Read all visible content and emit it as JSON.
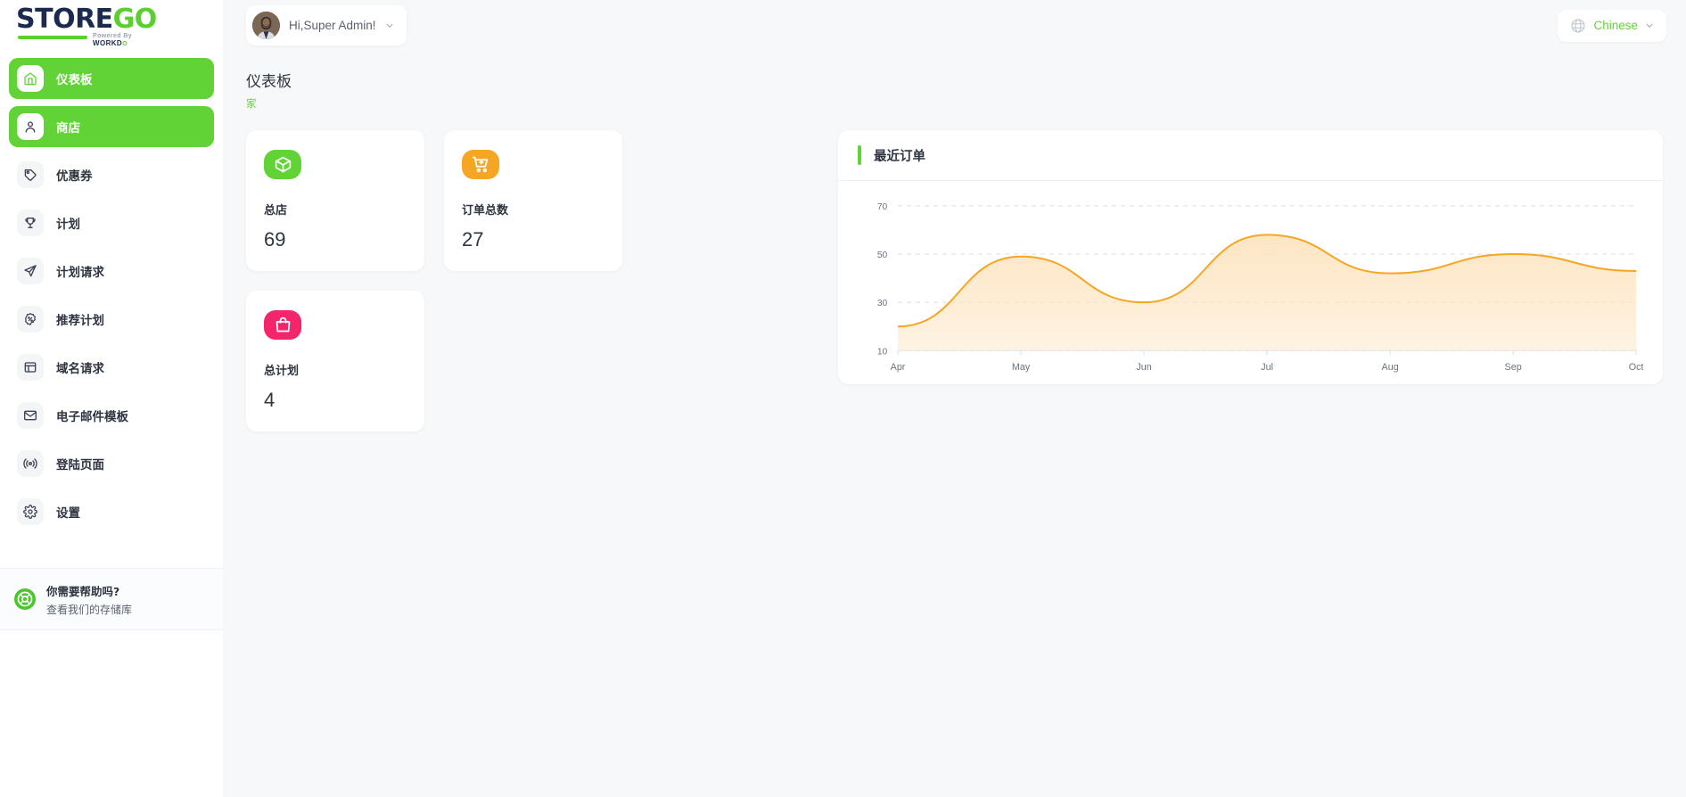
{
  "brand": {
    "logo_part1": "STORE",
    "logo_part2": "GO",
    "powered_prefix": "Powered By ",
    "powered_brand": "WORKD",
    "powered_accent": "O"
  },
  "sidebar": {
    "items": [
      {
        "label": "仪表板",
        "icon": "home-icon",
        "active": true
      },
      {
        "label": "商店",
        "icon": "user-icon",
        "active": true
      },
      {
        "label": "优惠券",
        "icon": "tag-icon",
        "active": false
      },
      {
        "label": "计划",
        "icon": "trophy-icon",
        "active": false
      },
      {
        "label": "计划请求",
        "icon": "send-icon",
        "active": false
      },
      {
        "label": "推荐计划",
        "icon": "percent-badge-icon",
        "active": false
      },
      {
        "label": "域名请求",
        "icon": "window-icon",
        "active": false
      },
      {
        "label": "电子邮件模板",
        "icon": "envelope-icon",
        "active": false
      },
      {
        "label": "登陆页面",
        "icon": "broadcast-icon",
        "active": false
      },
      {
        "label": "设置",
        "icon": "gear-icon",
        "active": false
      }
    ],
    "help": {
      "title": "你需要帮助吗?",
      "subtitle": "查看我们的存储库",
      "icon": "lifebuoy-icon"
    }
  },
  "topbar": {
    "greeting": "Hi,Super Admin!",
    "avatar_icon": "user-avatar",
    "chevron_icon": "chevron-down-icon",
    "language": "Chinese",
    "globe_icon": "globe-icon"
  },
  "page": {
    "title": "仪表板",
    "breadcrumb": "家"
  },
  "stats": [
    {
      "label": "总店",
      "value": "69",
      "icon": "box-icon",
      "color": "#62d336"
    },
    {
      "label": "订单总数",
      "value": "27",
      "icon": "cart-plus-icon",
      "color": "#f5a623"
    },
    {
      "label": "总计划",
      "value": "4",
      "icon": "shopping-bag-icon",
      "color": "#f5256b"
    }
  ],
  "chart_panel": {
    "title": "最近订单",
    "accent_color": "#62d336"
  },
  "chart_data": {
    "type": "area",
    "title": "最近订单",
    "xlabel": "",
    "ylabel": "",
    "categories": [
      "Apr",
      "May",
      "Jun",
      "Jul",
      "Aug",
      "Sep",
      "Oct"
    ],
    "values": [
      20,
      49,
      30,
      58,
      42,
      50,
      43
    ],
    "yticks": [
      10,
      30,
      50,
      70
    ],
    "ylim": [
      10,
      70
    ],
    "grid": true,
    "legend": "none",
    "line_color": "#f5a623",
    "fill_color": "#fde4c0",
    "smooth": true
  }
}
